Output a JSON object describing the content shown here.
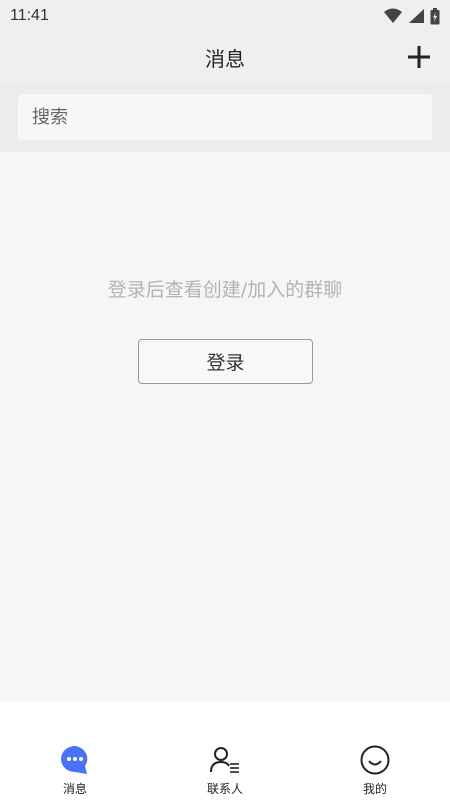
{
  "status_bar": {
    "time": "11:41"
  },
  "header": {
    "title": "消息",
    "add_icon": "plus-icon"
  },
  "search": {
    "placeholder": "搜索",
    "value": ""
  },
  "empty_state": {
    "message": "登录后查看创建/加入的群聊",
    "login_label": "登录"
  },
  "bottom_nav": {
    "active": "messages",
    "accent": "#4a72f5",
    "items": [
      {
        "id": "messages",
        "label": "消息",
        "icon": "chat-bubble-icon"
      },
      {
        "id": "contacts",
        "label": "联系人",
        "icon": "contacts-icon"
      },
      {
        "id": "me",
        "label": "我的",
        "icon": "smiley-icon"
      }
    ]
  },
  "colors": {
    "background": "#f5f6f8",
    "header": "#efefef",
    "accent": "#4a72f5"
  }
}
